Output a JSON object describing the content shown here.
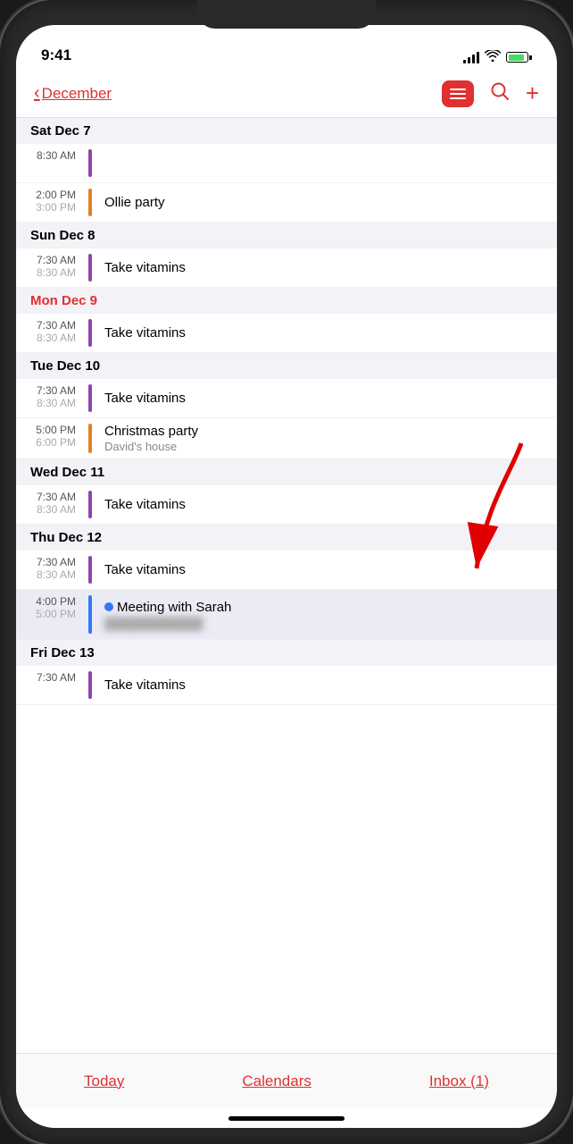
{
  "status": {
    "time": "9:41"
  },
  "nav": {
    "back_label": "December",
    "search_icon": "🔍",
    "add_icon": "+"
  },
  "days": [
    {
      "id": "sat-dec-7",
      "label": "Sat  Dec 7",
      "is_today": false,
      "events": [
        {
          "time_start": "8:30 AM",
          "time_end": "",
          "color": "#8e44ad",
          "title": "",
          "subtitle": "",
          "empty": true
        },
        {
          "time_start": "2:00 PM",
          "time_end": "3:00 PM",
          "color": "#e67e22",
          "title": "Ollie party",
          "subtitle": ""
        }
      ]
    },
    {
      "id": "sun-dec-8",
      "label": "Sun  Dec 8",
      "is_today": false,
      "events": [
        {
          "time_start": "7:30 AM",
          "time_end": "8:30 AM",
          "color": "#8e44ad",
          "title": "Take vitamins",
          "subtitle": ""
        }
      ]
    },
    {
      "id": "mon-dec-9",
      "label": "Mon  Dec 9",
      "is_today": true,
      "events": [
        {
          "time_start": "7:30 AM",
          "time_end": "8:30 AM",
          "color": "#8e44ad",
          "title": "Take vitamins",
          "subtitle": ""
        }
      ]
    },
    {
      "id": "tue-dec-10",
      "label": "Tue  Dec 10",
      "is_today": false,
      "events": [
        {
          "time_start": "7:30 AM",
          "time_end": "8:30 AM",
          "color": "#8e44ad",
          "title": "Take vitamins",
          "subtitle": ""
        },
        {
          "time_start": "5:00 PM",
          "time_end": "6:00 PM",
          "color": "#e67e22",
          "title": "Christmas party",
          "subtitle": "David's house"
        }
      ]
    },
    {
      "id": "wed-dec-11",
      "label": "Wed  Dec 11",
      "is_today": false,
      "events": [
        {
          "time_start": "7:30 AM",
          "time_end": "8:30 AM",
          "color": "#8e44ad",
          "title": "Take vitamins",
          "subtitle": ""
        }
      ]
    },
    {
      "id": "thu-dec-12",
      "label": "Thu  Dec 12",
      "is_today": false,
      "events": [
        {
          "time_start": "7:30 AM",
          "time_end": "8:30 AM",
          "color": "#8e44ad",
          "title": "Take vitamins",
          "subtitle": ""
        },
        {
          "time_start": "4:00 PM",
          "time_end": "5:00 PM",
          "color": "#3478f6",
          "title": "Meeting with Sarah",
          "subtitle": "",
          "has_dot": true,
          "highlighted": true,
          "blurred_subtitle": "••••••••••"
        }
      ]
    },
    {
      "id": "fri-dec-13",
      "label": "Fri  Dec 13",
      "is_today": false,
      "events": [
        {
          "time_start": "7:30 AM",
          "time_end": "",
          "color": "#8e44ad",
          "title": "Take vitamins",
          "subtitle": ""
        }
      ]
    }
  ],
  "tabs": {
    "today": "Today",
    "calendars": "Calendars",
    "inbox": "Inbox (1)"
  }
}
